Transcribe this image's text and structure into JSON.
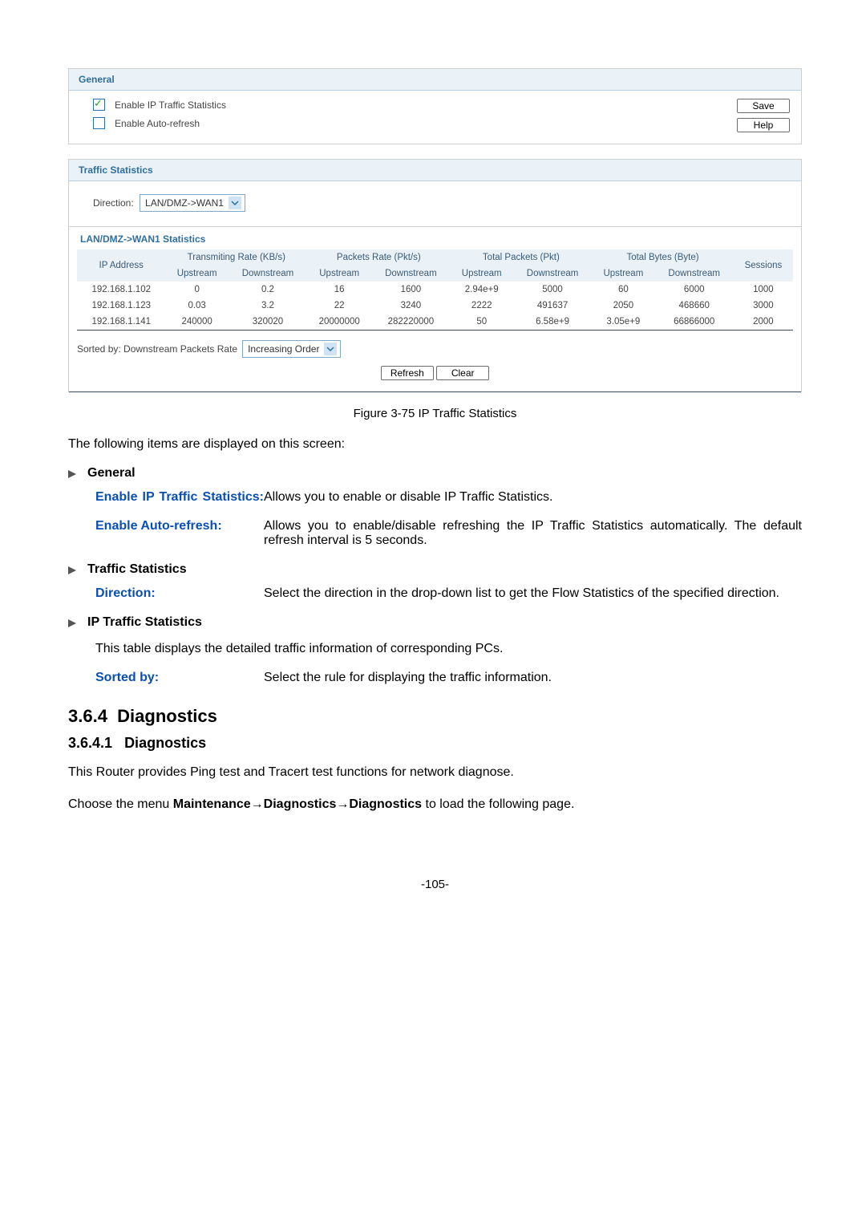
{
  "panel_general": {
    "title": "General",
    "enable_stats_label": "Enable IP Traffic Statistics",
    "enable_autorefresh_label": "Enable Auto-refresh",
    "save_btn": "Save",
    "help_btn": "Help"
  },
  "panel_traffic": {
    "title": "Traffic Statistics",
    "direction_label": "Direction:",
    "direction_value": "LAN/DMZ->WAN1"
  },
  "stats": {
    "subtitle": "LAN/DMZ->WAN1 Statistics",
    "col_ip": "IP Address",
    "col_trans": "Transmiting Rate (KB/s)",
    "col_pkt_rate": "Packets Rate (Pkt/s)",
    "col_total_pkt": "Total Packets (Pkt)",
    "col_total_bytes": "Total Bytes (Byte)",
    "col_sessions": "Sessions",
    "col_up": "Upstream",
    "col_down": "Downstream",
    "rows": [
      {
        "ip": "192.168.1.102",
        "tu": "0",
        "td": "0.2",
        "pu": "16",
        "pd": "1600",
        "tpu": "2.94e+9",
        "tpd": "5000",
        "bu": "60",
        "bd": "6000",
        "s": "1000"
      },
      {
        "ip": "192.168.1.123",
        "tu": "0.03",
        "td": "3.2",
        "pu": "22",
        "pd": "3240",
        "tpu": "2222",
        "tpd": "491637",
        "bu": "2050",
        "bd": "468660",
        "s": "3000"
      },
      {
        "ip": "192.168.1.141",
        "tu": "240000",
        "td": "320020",
        "pu": "20000000",
        "pd": "282220000",
        "tpu": "50",
        "tpd": "6.58e+9",
        "bu": "3.05e+9",
        "bd": "66866000",
        "s": "2000"
      }
    ],
    "sorted_by_label": "Sorted by: Downstream Packets Rate",
    "sort_order_value": "Increasing Order",
    "refresh_btn": "Refresh",
    "clear_btn": "Clear"
  },
  "caption": "Figure 3-75 IP Traffic Statistics",
  "doc": {
    "intro": "The following items are displayed on this screen:",
    "sec_general": "General",
    "lbl_enable_stats": "Enable IP Traffic Statistics:",
    "desc_enable_stats": "Allows you to enable or disable IP Traffic Statistics.",
    "lbl_enable_auto": "Enable Auto-refresh:",
    "desc_enable_auto": "Allows you to enable/disable refreshing the IP Traffic Statistics automatically. The default refresh interval is 5 seconds.",
    "sec_traffic": "Traffic Statistics",
    "lbl_direction": "Direction:",
    "desc_direction": "Select the direction in the drop-down list to get the Flow Statistics of the specified direction.",
    "sec_ip": "IP Traffic Statistics",
    "desc_ip_table": "This table displays the detailed traffic information of corresponding PCs.",
    "lbl_sorted": "Sorted by:",
    "desc_sorted": "Select the rule for displaying the traffic information.",
    "h2_num": "3.6.4",
    "h2_text": "Diagnostics",
    "h3_num": "3.6.4.1",
    "h3_text": "Diagnostics",
    "para_router": "This Router provides Ping test and Tracert test functions for network diagnose.",
    "nav_prefix": "Choose the menu ",
    "nav_1": "Maintenance",
    "nav_2": "Diagnostics",
    "nav_3": "Diagnostics",
    "nav_suffix": " to load the following page."
  },
  "page_number": "-105-"
}
